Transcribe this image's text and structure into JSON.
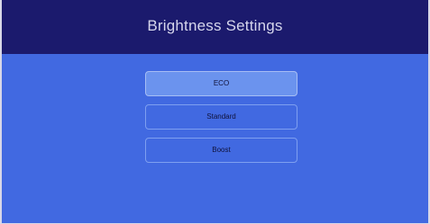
{
  "header": {
    "title": "Brightness Settings"
  },
  "options": {
    "items": [
      {
        "label": "ECO",
        "selected": true
      },
      {
        "label": "Standard",
        "selected": false
      },
      {
        "label": "Boost",
        "selected": false
      }
    ]
  },
  "colors": {
    "header_bg": "#1b1a6d",
    "content_bg": "#4169e1",
    "selected_bg": "#6b93ee",
    "title_text": "#d6d6ec"
  }
}
